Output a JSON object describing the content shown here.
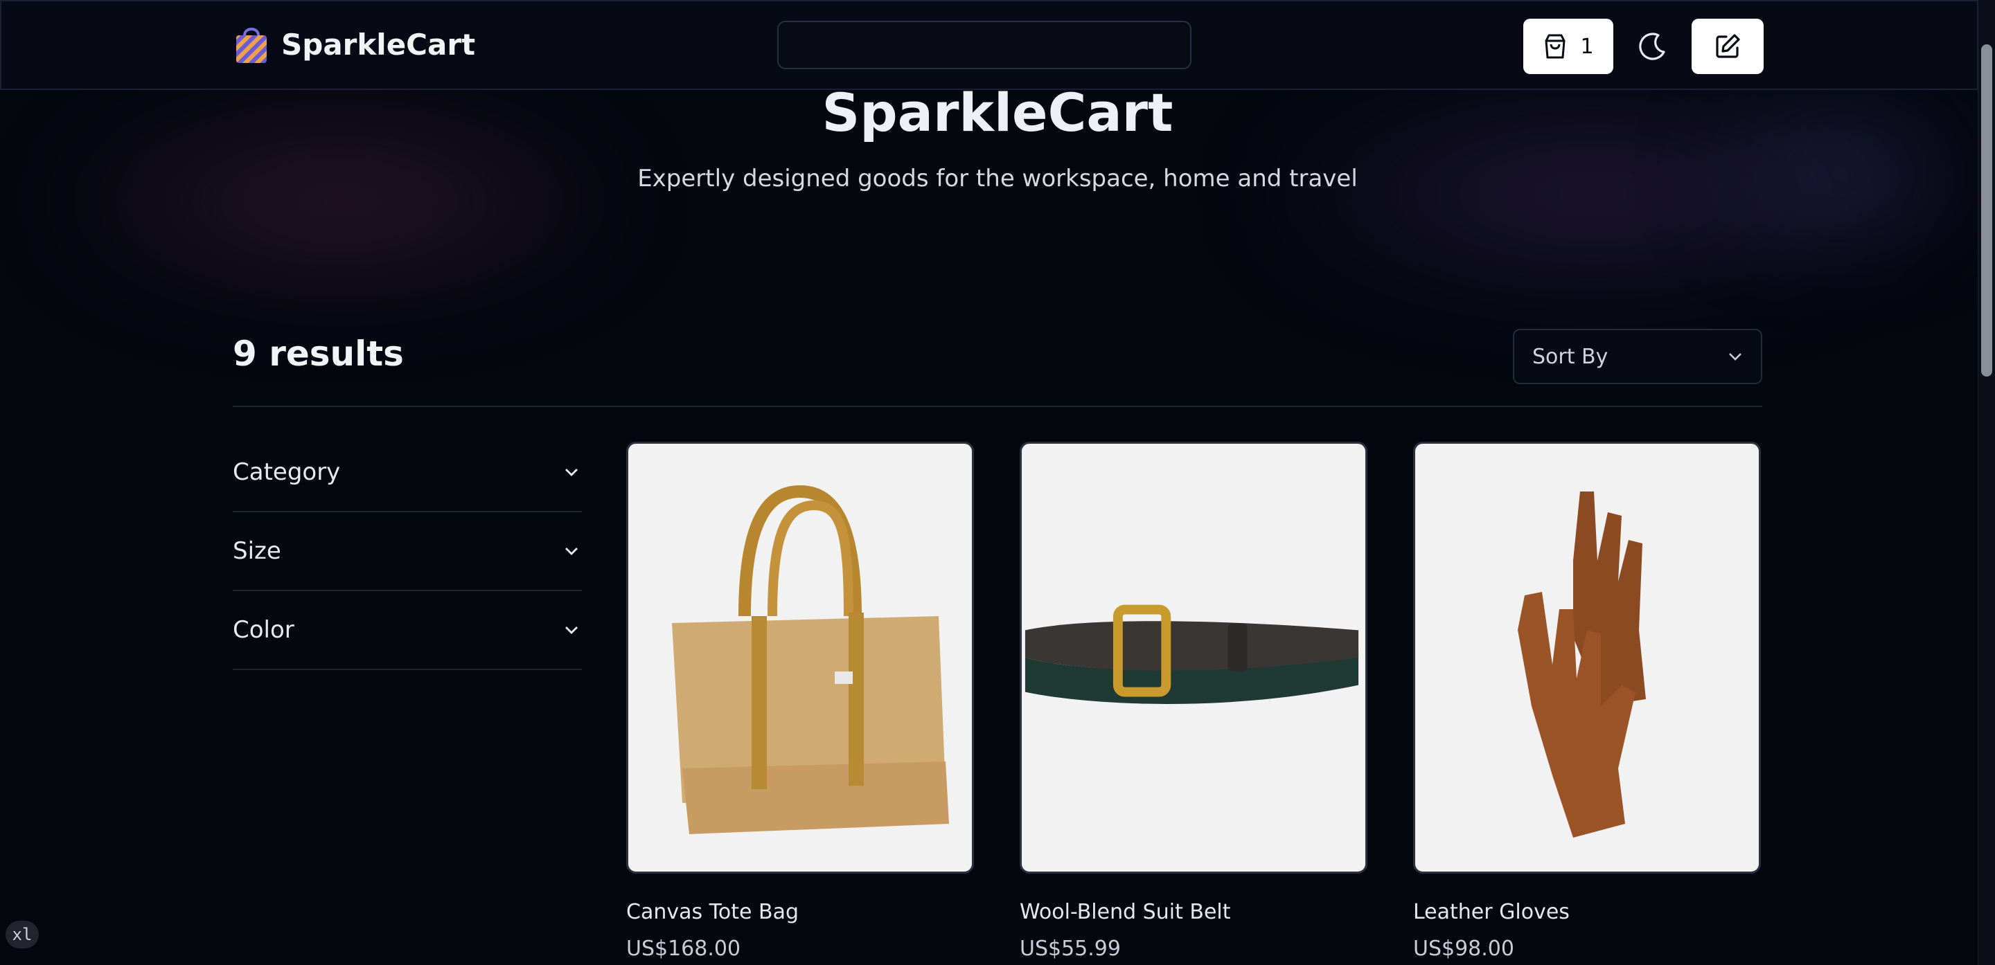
{
  "header": {
    "brand": "SparkleCart",
    "search": {
      "placeholder": ""
    },
    "cart_count": "1",
    "icons": [
      "shopping-bag-logo-icon",
      "cart-icon",
      "moon-icon",
      "edit-icon"
    ]
  },
  "hero": {
    "title": "SparkleCart",
    "subtitle": "Expertly designed goods for the workspace, home and travel"
  },
  "results": {
    "count_label": "9 results",
    "sort_label": "Sort By"
  },
  "filters": [
    {
      "label": "Category"
    },
    {
      "label": "Size"
    },
    {
      "label": "Color"
    }
  ],
  "products": [
    {
      "name": "Canvas Tote Bag",
      "price": "US$168.00"
    },
    {
      "name": "Wool-Blend Suit Belt",
      "price": "US$55.99"
    },
    {
      "name": "Leather Gloves",
      "price": "US$98.00"
    }
  ],
  "breakpoint_badge": "xl",
  "colors": {
    "background": "#05070f",
    "accent": "#ffffff"
  }
}
